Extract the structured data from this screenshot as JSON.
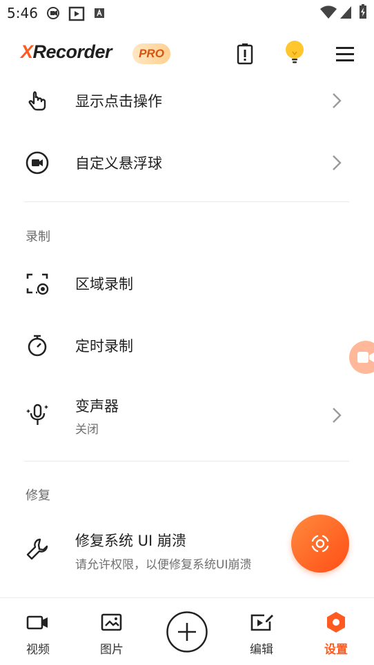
{
  "status_bar": {
    "time": "5:46"
  },
  "header": {
    "logo_x": "X",
    "logo_rest": "Recorder",
    "pro_badge": "PRO"
  },
  "rows_top": [
    {
      "title": "显示点击操作"
    },
    {
      "title": "自定义悬浮球"
    }
  ],
  "section_record": {
    "header": "录制",
    "rows": [
      {
        "title": "区域录制"
      },
      {
        "title": "定时录制"
      },
      {
        "title": "变声器",
        "subtitle": "关闭"
      }
    ]
  },
  "section_repair": {
    "header": "修复",
    "rows": [
      {
        "title": "修复系统 UI 崩溃",
        "subtitle": "请允许权限，以便修复系统UI崩溃"
      }
    ]
  },
  "bottom_nav": [
    {
      "label": "视频"
    },
    {
      "label": "图片"
    },
    {
      "label": ""
    },
    {
      "label": "编辑"
    },
    {
      "label": "设置",
      "active": true
    }
  ],
  "colors": {
    "accent": "#ff5a1f",
    "active_tab": "#ff5a1f"
  }
}
